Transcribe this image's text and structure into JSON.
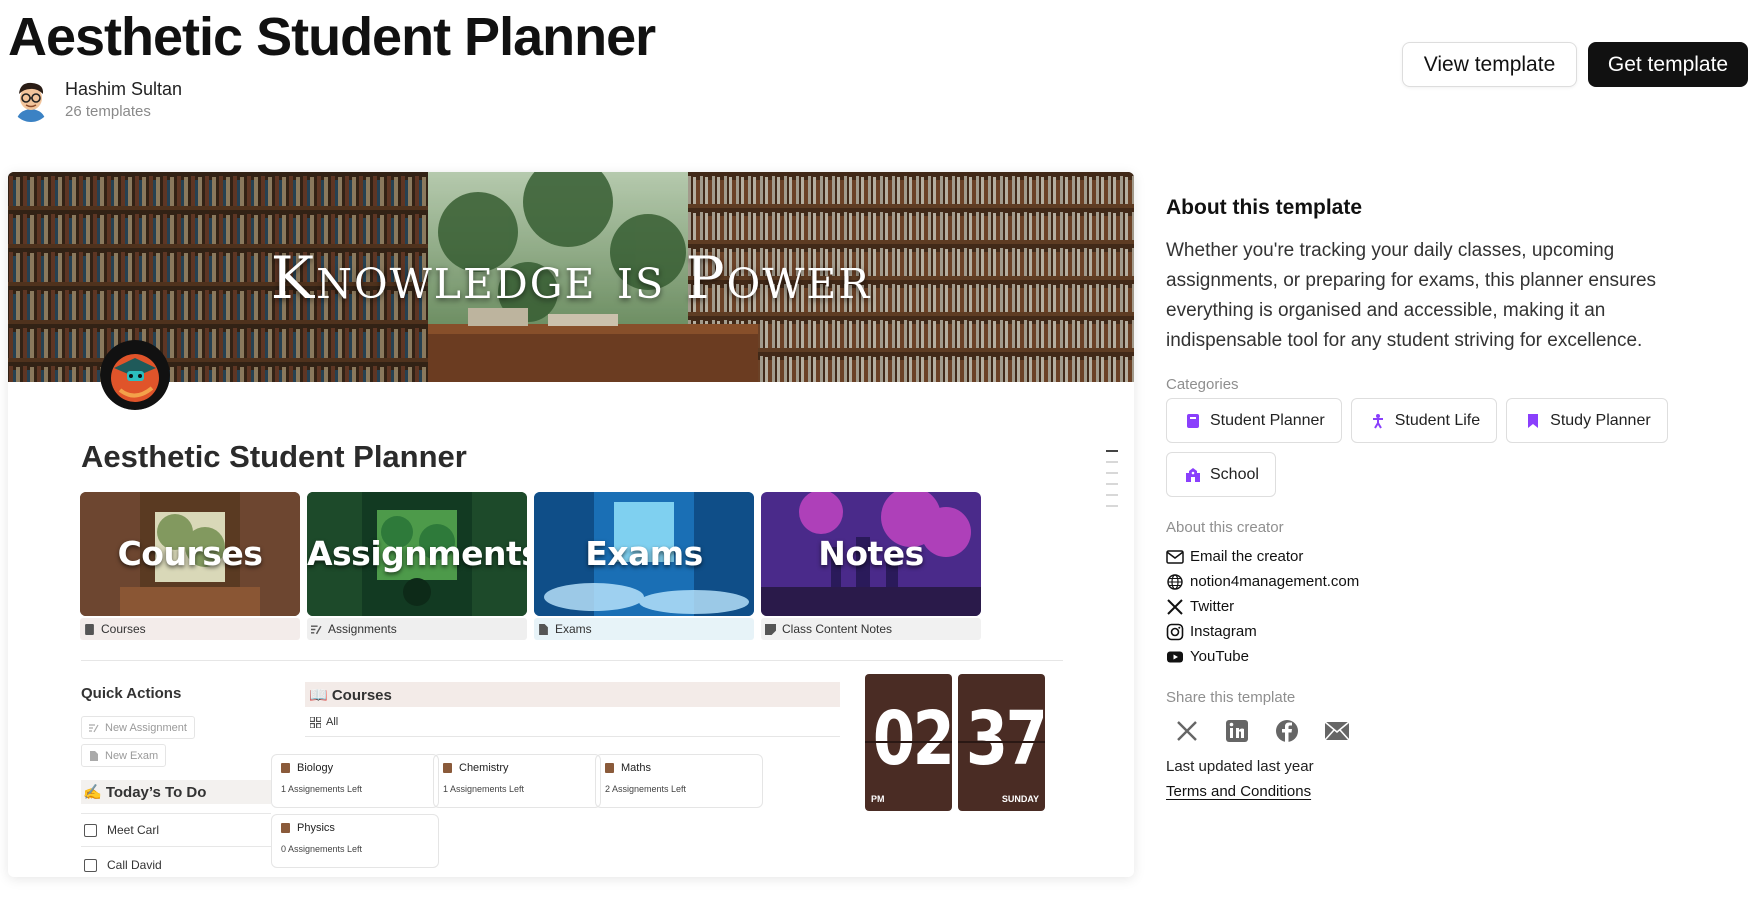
{
  "header": {
    "title": "Aesthetic Student Planner",
    "author_name": "Hashim Sultan",
    "author_templates": "26 templates",
    "view_label": "View template",
    "get_label": "Get template"
  },
  "preview": {
    "cover_title": "Knowledge is Power",
    "page_title": "Aesthetic Student Planner",
    "gallery": [
      {
        "word": "Courses",
        "caption": "Courses",
        "icon": "book-icon"
      },
      {
        "word": "Assignments",
        "caption": "Assignments",
        "icon": "pencil-lines-icon"
      },
      {
        "word": "Exams",
        "caption": "Exams",
        "icon": "document-icon"
      },
      {
        "word": "Notes",
        "caption": "Class Content Notes",
        "icon": "sticky-note-icon"
      }
    ],
    "quick_actions": {
      "title": "Quick Actions",
      "new_assignment": "New Assignment",
      "new_exam": "New Exam"
    },
    "todo": {
      "title": "✍️ Today’s To Do",
      "items": [
        "Meet Carl",
        "Call David"
      ]
    },
    "courses": {
      "title": "📖 Courses",
      "view": "All",
      "cards": [
        {
          "name": "Biology",
          "left": "1 Assignements Left"
        },
        {
          "name": "Chemistry",
          "left": "1 Assignements Left"
        },
        {
          "name": "Maths",
          "left": "2 Assignements Left"
        },
        {
          "name": "Physics",
          "left": "0 Assignements Left"
        }
      ]
    },
    "clock": {
      "hours": "02",
      "minutes": "37",
      "ampm": "PM",
      "day": "SUNDAY"
    }
  },
  "sidebar": {
    "about_title": "About this template",
    "description": "Whether you're tracking your daily classes, upcoming assignments, or preparing for exams, this planner ensures everything is organised and accessible, making it an indispensable tool for any student striving for excellence.",
    "categories_label": "Categories",
    "categories": [
      {
        "label": "Student Planner",
        "icon": "notebook-icon"
      },
      {
        "label": "Student Life",
        "icon": "person-icon"
      },
      {
        "label": "Study Planner",
        "icon": "bookmark-icon"
      },
      {
        "label": "School",
        "icon": "school-icon"
      }
    ],
    "creator_label": "About this creator",
    "links": [
      {
        "label": "Email the creator",
        "icon": "mail-icon"
      },
      {
        "label": "notion4management.com",
        "icon": "globe-icon"
      },
      {
        "label": "Twitter",
        "icon": "x-icon"
      },
      {
        "label": "Instagram",
        "icon": "instagram-icon"
      },
      {
        "label": "YouTube",
        "icon": "youtube-icon"
      }
    ],
    "share_label": "Share this template",
    "updated": "Last updated last year",
    "terms": "Terms and Conditions"
  },
  "colors": {
    "accent_purple": "#8a3ffc",
    "clock_brown": "#4a2c24",
    "button_dark": "#111111"
  }
}
